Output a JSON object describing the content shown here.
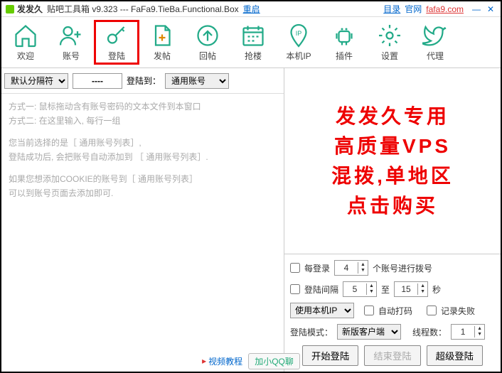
{
  "titlebar": {
    "app_name": "发发久",
    "subtitle": "贴吧工具箱 v9.323 --- FaFa9.TieBa.Functional.Box",
    "reset": "重启",
    "catalog": "目录",
    "site_label": "官网",
    "site_url": "fafa9.com"
  },
  "toolbar": {
    "items": [
      {
        "label": "欢迎",
        "name": "welcome"
      },
      {
        "label": "账号",
        "name": "account"
      },
      {
        "label": "登陆",
        "name": "login"
      },
      {
        "label": "发帖",
        "name": "post"
      },
      {
        "label": "回帖",
        "name": "reply"
      },
      {
        "label": "抢楼",
        "name": "grab"
      },
      {
        "label": "本机IP",
        "name": "local-ip"
      },
      {
        "label": "插件",
        "name": "plugin"
      },
      {
        "label": "设置",
        "name": "settings"
      },
      {
        "label": "代理",
        "name": "proxy"
      }
    ]
  },
  "filterbar": {
    "delimiter_label": "默认分隔符",
    "delimiter_value": "----",
    "login_to_label": "登陆到：",
    "login_to_value": "通用账号"
  },
  "left_hints": {
    "p1": "方式一: 鼠标拖动含有账号密码的文本文件到本窗口\n方式二: 在这里输入, 每行一组",
    "p2": "您当前选择的是［ 通用账号列表］,\n登陆成功后, 会把账号自动添加到 ［ 通用账号列表］.",
    "p3": "如果您想添加COOKIE的账号到［ 通用账号列表］\n可以到账号页面去添加即可."
  },
  "ad": {
    "l1": "发发久专用",
    "l2": "高质量VPS",
    "l3": "混拨,单地区",
    "l4": "点击购买"
  },
  "settings": {
    "every_login_label": "每登录",
    "every_login_val": "4",
    "every_login_suffix": "个账号进行拨号",
    "interval_label": "登陆间隔",
    "interval_from": "5",
    "to_label": "至",
    "interval_to": "15",
    "seconds": "秒",
    "ip_mode": "使用本机IP",
    "auto_captcha": "自动打码",
    "log_fail": "记录失败",
    "login_mode_label": "登陆模式：",
    "login_mode_value": "新版客户端",
    "threads_label": "线程数：",
    "threads_value": "1",
    "start": "开始登陆",
    "end": "结束登陆",
    "super": "超级登陆"
  },
  "footer": {
    "video": "视频教程",
    "qq": "加小QQ聊"
  }
}
